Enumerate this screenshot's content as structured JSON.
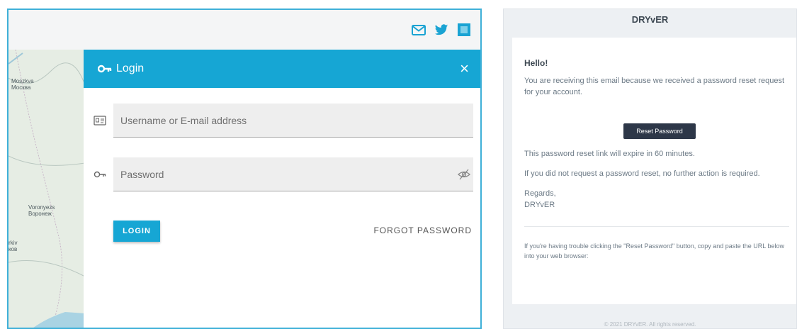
{
  "login_page": {
    "header_icons": [
      "mail-icon",
      "twitter-icon",
      "social-icon"
    ],
    "map_cities": [
      {
        "name": "Moszkva",
        "native": "Москва"
      },
      {
        "name": "Voronyezs",
        "native": "Воронеж"
      },
      {
        "name": "rkiv",
        "native": "ков"
      }
    ],
    "modal": {
      "title": "Login",
      "close_label": "×",
      "username_placeholder": "Username or E-mail address",
      "password_placeholder": "Password",
      "login_label": "LOGIN",
      "forgot_label": "FORGOT PASSWORD"
    },
    "colors": {
      "accent": "#16a6d4",
      "header_bg": "#f4f5f6"
    }
  },
  "email": {
    "brand": "DRYvER",
    "greeting": "Hello!",
    "intro": "You are receiving this email because we received a password reset request for your account.",
    "button_label": "Reset Password",
    "expire_text": "This password reset link will expire in 60 minutes.",
    "no_action_text": "If you did not request a password reset, no further action is required.",
    "regards": "Regards,",
    "signature": "DRYvER",
    "trouble_text": "If you're having trouble clicking the \"Reset Password\" button, copy and paste the URL below into your web browser:",
    "footer": "© 2021 DRYvER. All rights reserved.",
    "colors": {
      "button_bg": "#2d3748",
      "text": "#6c7a86"
    }
  }
}
